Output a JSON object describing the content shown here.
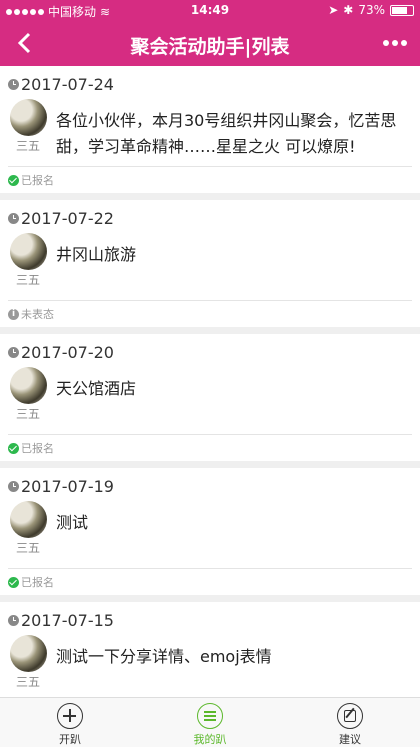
{
  "statusbar": {
    "carrier": "中国移动",
    "time": "14:49",
    "battery": "73%"
  },
  "header": {
    "title": "聚会活动助手|列表"
  },
  "events": [
    {
      "date": "2017-07-24",
      "author": "三五",
      "text": "各位小伙伴，本月30号组织井冈山聚会，忆苦思甜，学习革命精神……星星之火 可以燎原!",
      "status": "已报名",
      "status_type": "joined"
    },
    {
      "date": "2017-07-22",
      "author": "三五",
      "text": "井冈山旅游",
      "status": "未表态",
      "status_type": "undecided"
    },
    {
      "date": "2017-07-20",
      "author": "三五",
      "text": "天公馆酒店",
      "status": "已报名",
      "status_type": "joined"
    },
    {
      "date": "2017-07-19",
      "author": "三五",
      "text": "测试",
      "status": "已报名",
      "status_type": "joined"
    },
    {
      "date": "2017-07-15",
      "author": "三五",
      "text": "测试一下分享详情、emoj表情",
      "status": "",
      "status_type": ""
    }
  ],
  "tabbar": {
    "tab1": "开趴",
    "tab2": "我的趴",
    "tab3": "建议"
  },
  "colors": {
    "brand": "#d62c82",
    "active_tab": "#5cb82c",
    "joined": "#2db84d"
  }
}
